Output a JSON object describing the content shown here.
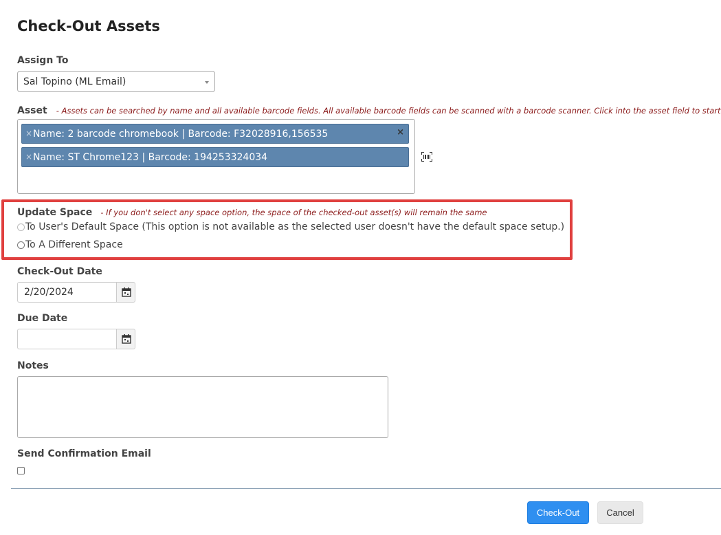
{
  "page": {
    "title": "Check-Out Assets"
  },
  "assign_to": {
    "label": "Assign To",
    "selected": "Sal Topino (ML Email)"
  },
  "asset": {
    "label": "Asset",
    "hint": "- Assets can be searched by name and all available barcode fields. All available barcode fields can be scanned with a barcode scanner. Click into the asset field to start!",
    "tags": [
      {
        "text": "Name: 2 barcode chromebook | Barcode: F32028916,156535"
      },
      {
        "text": "Name: ST Chrome123 | Barcode: 194253324034"
      }
    ],
    "tag_remove_glyph": "×",
    "clear_glyph": "×",
    "scanner_icon": "barcode-icon"
  },
  "update_space": {
    "label": "Update Space",
    "hint": "- If you don't select any space option, the space of the checked-out asset(s) will remain the same",
    "options": [
      {
        "label": "To User's Default Space (This option is not available as the selected user doesn't have the default space setup.)"
      },
      {
        "label": "To A Different Space"
      }
    ],
    "highlight_color": "#e0403f"
  },
  "checkout_date": {
    "label": "Check-Out Date",
    "value": "2/20/2024",
    "icon": "calendar-icon"
  },
  "due_date": {
    "label": "Due Date",
    "value": "",
    "icon": "calendar-icon"
  },
  "notes": {
    "label": "Notes",
    "value": ""
  },
  "confirmation": {
    "label": "Send Confirmation Email"
  },
  "actions": {
    "primary": "Check-Out",
    "secondary": "Cancel",
    "primary_color": "#2f8ff0"
  }
}
